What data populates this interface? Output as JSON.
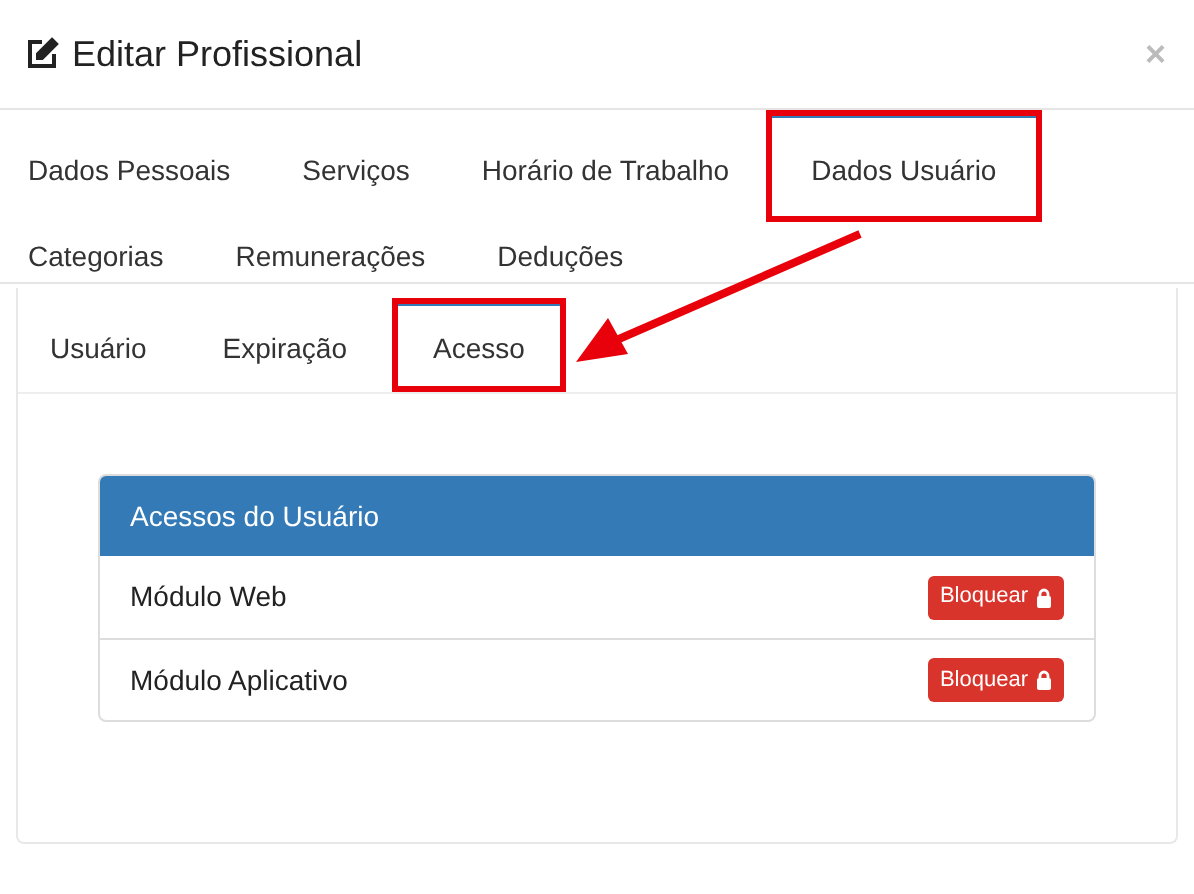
{
  "dialog": {
    "title": "Editar Profissional",
    "close": "×"
  },
  "tabs": [
    {
      "label": "Dados Pessoais",
      "selected": false,
      "annotated": false
    },
    {
      "label": "Serviços",
      "selected": false,
      "annotated": false
    },
    {
      "label": "Horário de Trabalho",
      "selected": false,
      "annotated": false
    },
    {
      "label": "Dados Usuário",
      "selected": true,
      "annotated": true
    },
    {
      "label": "Categorias",
      "selected": false,
      "annotated": false
    },
    {
      "label": "Remunerações",
      "selected": false,
      "annotated": false
    },
    {
      "label": "Deduções",
      "selected": false,
      "annotated": false
    }
  ],
  "subtabs": [
    {
      "label": "Usuário",
      "selected": false,
      "annotated": false
    },
    {
      "label": "Expiração",
      "selected": false,
      "annotated": false
    },
    {
      "label": "Acesso",
      "selected": true,
      "annotated": true
    }
  ],
  "panel": {
    "title": "Acessos do Usuário",
    "rows": [
      {
        "module": "Módulo Web",
        "action": "Bloquear"
      },
      {
        "module": "Módulo Aplicativo",
        "action": "Bloquear"
      }
    ]
  }
}
